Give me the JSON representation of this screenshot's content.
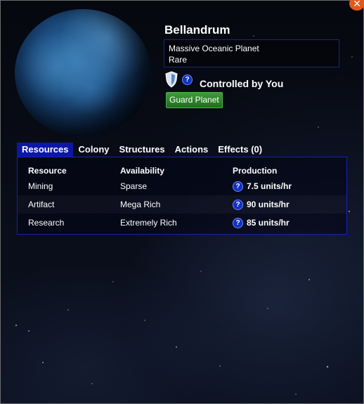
{
  "planet": {
    "name": "Bellandrum",
    "type_line": "Massive Oceanic Planet",
    "rarity": "Rare",
    "control_status": "Controlled by You",
    "guard_button": "Guard Planet"
  },
  "icons": {
    "close": "close-icon",
    "shield": "shield-icon",
    "help": "help-icon",
    "help_glyph": "?"
  },
  "tabs": [
    {
      "label": "Resources",
      "active": true
    },
    {
      "label": "Colony",
      "active": false
    },
    {
      "label": "Structures",
      "active": false
    },
    {
      "label": "Actions",
      "active": false
    },
    {
      "label": "Effects (0)",
      "active": false
    }
  ],
  "resources": {
    "headers": {
      "resource": "Resource",
      "availability": "Availability",
      "production": "Production"
    },
    "rows": [
      {
        "resource": "Mining",
        "availability": "Sparse",
        "production": "7.5 units/hr"
      },
      {
        "resource": "Artifact",
        "availability": "Mega Rich",
        "production": "90 units/hr"
      },
      {
        "resource": "Research",
        "availability": "Extremely Rich",
        "production": "85 units/hr"
      }
    ]
  },
  "colors": {
    "active_tab": "#0c17a8",
    "guard_button": "#2e8a2b",
    "close_button": "#e05a1a",
    "panel_border": "#1420c0"
  }
}
